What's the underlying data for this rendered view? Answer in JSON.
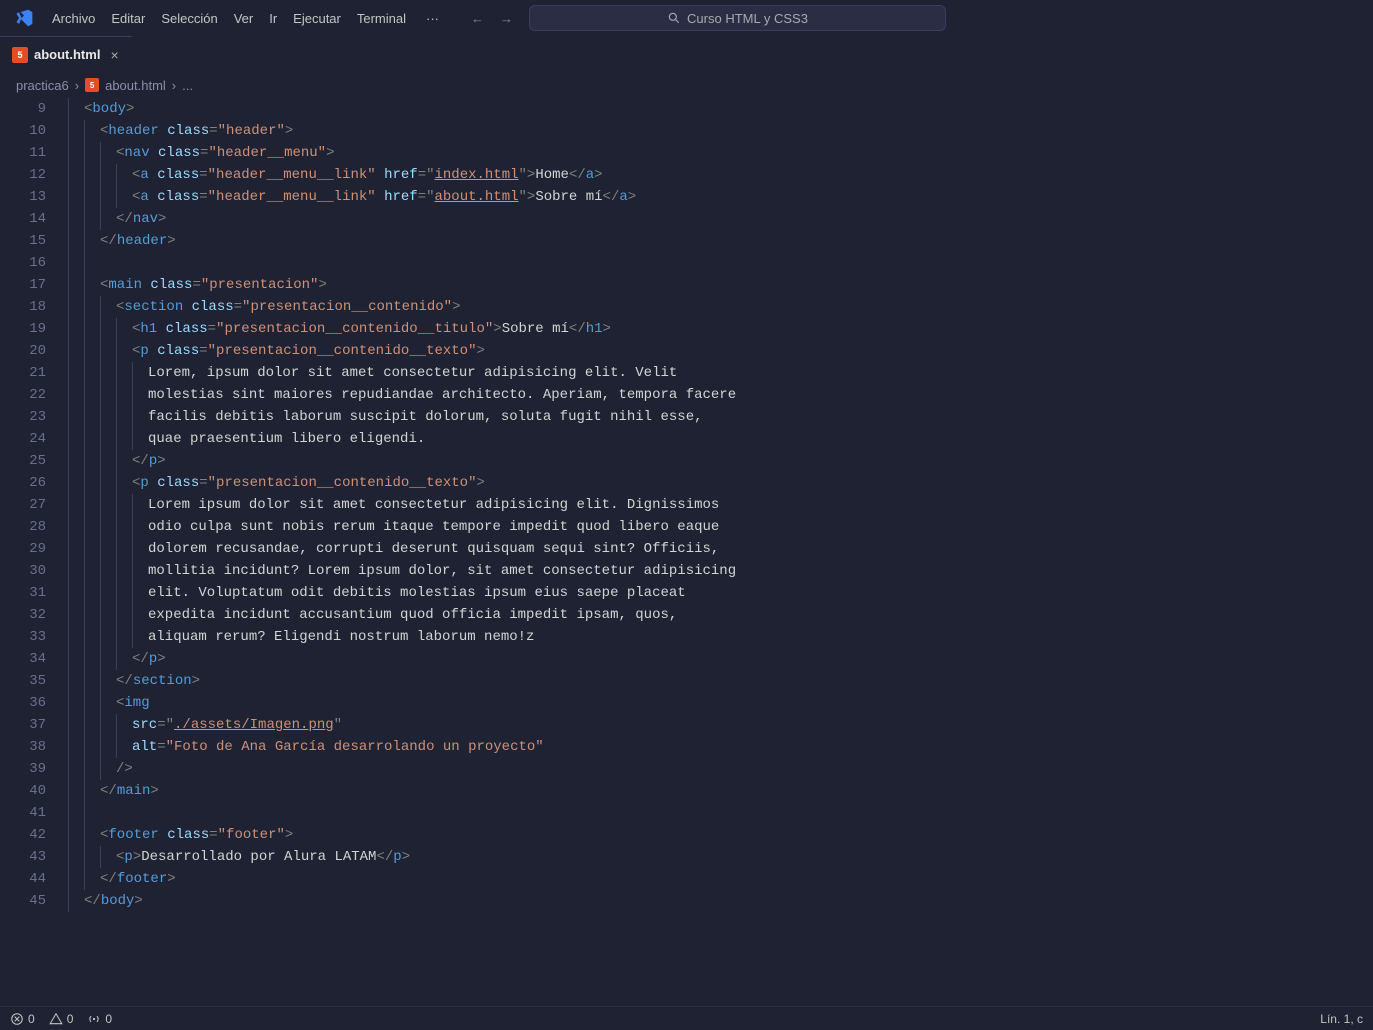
{
  "titlebar": {
    "menus": [
      "Archivo",
      "Editar",
      "Selección",
      "Ver",
      "Ir",
      "Ejecutar",
      "Terminal"
    ],
    "search_text": "Curso HTML y CSS3"
  },
  "tabs": [
    {
      "label": "about.html",
      "icon": "5"
    }
  ],
  "breadcrumbs": {
    "items": [
      "practica6",
      "about.html"
    ],
    "trailing": "..."
  },
  "gutter": {
    "start": 9,
    "end": 45
  },
  "code": {
    "lines": [
      {
        "indent": 1,
        "tokens": [
          [
            "punct",
            "<"
          ],
          [
            "tag",
            "body"
          ],
          [
            "punct",
            ">"
          ]
        ]
      },
      {
        "indent": 2,
        "tokens": [
          [
            "punct",
            "<"
          ],
          [
            "tag",
            "header"
          ],
          [
            "text",
            " "
          ],
          [
            "attr",
            "class"
          ],
          [
            "punct",
            "="
          ],
          [
            "str",
            "\"header\""
          ],
          [
            "punct",
            ">"
          ]
        ]
      },
      {
        "indent": 3,
        "tokens": [
          [
            "punct",
            "<"
          ],
          [
            "tag",
            "nav"
          ],
          [
            "text",
            " "
          ],
          [
            "attr",
            "class"
          ],
          [
            "punct",
            "="
          ],
          [
            "str",
            "\"header__menu\""
          ],
          [
            "punct",
            ">"
          ]
        ]
      },
      {
        "indent": 4,
        "tokens": [
          [
            "punct",
            "<"
          ],
          [
            "tag",
            "a"
          ],
          [
            "text",
            " "
          ],
          [
            "attr",
            "class"
          ],
          [
            "punct",
            "="
          ],
          [
            "str",
            "\"header__menu__link\""
          ],
          [
            "text",
            " "
          ],
          [
            "attr",
            "href"
          ],
          [
            "punct",
            "="
          ],
          [
            "punct",
            "\""
          ],
          [
            "link",
            "index.html"
          ],
          [
            "punct",
            "\""
          ],
          [
            "punct",
            ">"
          ],
          [
            "text",
            "Home"
          ],
          [
            "punct",
            "</"
          ],
          [
            "tag",
            "a"
          ],
          [
            "punct",
            ">"
          ]
        ]
      },
      {
        "indent": 4,
        "tokens": [
          [
            "punct",
            "<"
          ],
          [
            "tag",
            "a"
          ],
          [
            "text",
            " "
          ],
          [
            "attr",
            "class"
          ],
          [
            "punct",
            "="
          ],
          [
            "str",
            "\"header__menu__link\""
          ],
          [
            "text",
            " "
          ],
          [
            "attr",
            "href"
          ],
          [
            "punct",
            "="
          ],
          [
            "punct",
            "\""
          ],
          [
            "link",
            "about.html"
          ],
          [
            "punct",
            "\""
          ],
          [
            "punct",
            ">"
          ],
          [
            "text",
            "Sobre mí"
          ],
          [
            "punct",
            "</"
          ],
          [
            "tag",
            "a"
          ],
          [
            "punct",
            ">"
          ]
        ]
      },
      {
        "indent": 3,
        "tokens": [
          [
            "punct",
            "</"
          ],
          [
            "tag",
            "nav"
          ],
          [
            "punct",
            ">"
          ]
        ]
      },
      {
        "indent": 2,
        "tokens": [
          [
            "punct",
            "</"
          ],
          [
            "tag",
            "header"
          ],
          [
            "punct",
            ">"
          ]
        ]
      },
      {
        "indent": 2,
        "tokens": []
      },
      {
        "indent": 2,
        "tokens": [
          [
            "punct",
            "<"
          ],
          [
            "tag",
            "main"
          ],
          [
            "text",
            " "
          ],
          [
            "attr",
            "class"
          ],
          [
            "punct",
            "="
          ],
          [
            "str",
            "\"presentacion\""
          ],
          [
            "punct",
            ">"
          ]
        ]
      },
      {
        "indent": 3,
        "tokens": [
          [
            "punct",
            "<"
          ],
          [
            "tag",
            "section"
          ],
          [
            "text",
            " "
          ],
          [
            "attr",
            "class"
          ],
          [
            "punct",
            "="
          ],
          [
            "str",
            "\"presentacion__contenido\""
          ],
          [
            "punct",
            ">"
          ]
        ]
      },
      {
        "indent": 4,
        "tokens": [
          [
            "punct",
            "<"
          ],
          [
            "tag",
            "h1"
          ],
          [
            "text",
            " "
          ],
          [
            "attr",
            "class"
          ],
          [
            "punct",
            "="
          ],
          [
            "str",
            "\"presentacion__contenido__titulo\""
          ],
          [
            "punct",
            ">"
          ],
          [
            "text",
            "Sobre mí"
          ],
          [
            "punct",
            "</"
          ],
          [
            "tag",
            "h1"
          ],
          [
            "punct",
            ">"
          ]
        ]
      },
      {
        "indent": 4,
        "tokens": [
          [
            "punct",
            "<"
          ],
          [
            "tag",
            "p"
          ],
          [
            "text",
            " "
          ],
          [
            "attr",
            "class"
          ],
          [
            "punct",
            "="
          ],
          [
            "str",
            "\"presentacion__contenido__texto\""
          ],
          [
            "punct",
            ">"
          ]
        ]
      },
      {
        "indent": 5,
        "tokens": [
          [
            "text",
            "Lorem, ipsum dolor sit amet consectetur adipisicing elit. Velit"
          ]
        ]
      },
      {
        "indent": 5,
        "tokens": [
          [
            "text",
            "molestias sint maiores repudiandae architecto. Aperiam, tempora facere"
          ]
        ]
      },
      {
        "indent": 5,
        "tokens": [
          [
            "text",
            "facilis debitis laborum suscipit dolorum, soluta fugit nihil esse,"
          ]
        ]
      },
      {
        "indent": 5,
        "tokens": [
          [
            "text",
            "quae praesentium libero eligendi."
          ]
        ]
      },
      {
        "indent": 4,
        "tokens": [
          [
            "punct",
            "</"
          ],
          [
            "tag",
            "p"
          ],
          [
            "punct",
            ">"
          ]
        ]
      },
      {
        "indent": 4,
        "tokens": [
          [
            "punct",
            "<"
          ],
          [
            "tag",
            "p"
          ],
          [
            "text",
            " "
          ],
          [
            "attr",
            "class"
          ],
          [
            "punct",
            "="
          ],
          [
            "str",
            "\"presentacion__contenido__texto\""
          ],
          [
            "punct",
            ">"
          ]
        ]
      },
      {
        "indent": 5,
        "tokens": [
          [
            "text",
            "Lorem ipsum dolor sit amet consectetur adipisicing elit. Dignissimos"
          ]
        ]
      },
      {
        "indent": 5,
        "tokens": [
          [
            "text",
            "odio culpa sunt nobis rerum itaque tempore impedit quod libero eaque"
          ]
        ]
      },
      {
        "indent": 5,
        "tokens": [
          [
            "text",
            "dolorem recusandae, corrupti deserunt quisquam sequi sint? Officiis,"
          ]
        ]
      },
      {
        "indent": 5,
        "tokens": [
          [
            "text",
            "mollitia incidunt? Lorem ipsum dolor, sit amet consectetur adipisicing"
          ]
        ]
      },
      {
        "indent": 5,
        "tokens": [
          [
            "text",
            "elit. Voluptatum odit debitis molestias ipsum eius saepe placeat"
          ]
        ]
      },
      {
        "indent": 5,
        "tokens": [
          [
            "text",
            "expedita incidunt accusantium quod officia impedit ipsam, quos,"
          ]
        ]
      },
      {
        "indent": 5,
        "tokens": [
          [
            "text",
            "aliquam rerum? Eligendi nostrum laborum nemo!z"
          ]
        ]
      },
      {
        "indent": 4,
        "tokens": [
          [
            "punct",
            "</"
          ],
          [
            "tag",
            "p"
          ],
          [
            "punct",
            ">"
          ]
        ]
      },
      {
        "indent": 3,
        "tokens": [
          [
            "punct",
            "</"
          ],
          [
            "tag",
            "section"
          ],
          [
            "punct",
            ">"
          ]
        ]
      },
      {
        "indent": 3,
        "tokens": [
          [
            "punct",
            "<"
          ],
          [
            "tag",
            "img"
          ]
        ]
      },
      {
        "indent": 4,
        "tokens": [
          [
            "attr",
            "src"
          ],
          [
            "punct",
            "="
          ],
          [
            "punct",
            "\""
          ],
          [
            "link",
            "./assets/Imagen.png"
          ],
          [
            "punct",
            "\""
          ]
        ]
      },
      {
        "indent": 4,
        "tokens": [
          [
            "attr",
            "alt"
          ],
          [
            "punct",
            "="
          ],
          [
            "str",
            "\"Foto de Ana García desarrolando un proyecto\""
          ]
        ]
      },
      {
        "indent": 3,
        "tokens": [
          [
            "punct",
            "/>"
          ]
        ]
      },
      {
        "indent": 2,
        "tokens": [
          [
            "punct",
            "</"
          ],
          [
            "tag",
            "main"
          ],
          [
            "punct",
            ">"
          ]
        ]
      },
      {
        "indent": 2,
        "tokens": []
      },
      {
        "indent": 2,
        "tokens": [
          [
            "punct",
            "<"
          ],
          [
            "tag",
            "footer"
          ],
          [
            "text",
            " "
          ],
          [
            "attr",
            "class"
          ],
          [
            "punct",
            "="
          ],
          [
            "str",
            "\"footer\""
          ],
          [
            "punct",
            ">"
          ]
        ]
      },
      {
        "indent": 3,
        "tokens": [
          [
            "punct",
            "<"
          ],
          [
            "tag",
            "p"
          ],
          [
            "punct",
            ">"
          ],
          [
            "text",
            "Desarrollado por Alura LATAM"
          ],
          [
            "punct",
            "</"
          ],
          [
            "tag",
            "p"
          ],
          [
            "punct",
            ">"
          ]
        ]
      },
      {
        "indent": 2,
        "tokens": [
          [
            "punct",
            "</"
          ],
          [
            "tag",
            "footer"
          ],
          [
            "punct",
            ">"
          ]
        ]
      },
      {
        "indent": 1,
        "tokens": [
          [
            "punct",
            "</"
          ],
          [
            "tag",
            "body"
          ],
          [
            "punct",
            ">"
          ]
        ]
      }
    ]
  },
  "status": {
    "errors": "0",
    "warnings": "0",
    "ports": "0",
    "position": "Lín. 1, c"
  }
}
